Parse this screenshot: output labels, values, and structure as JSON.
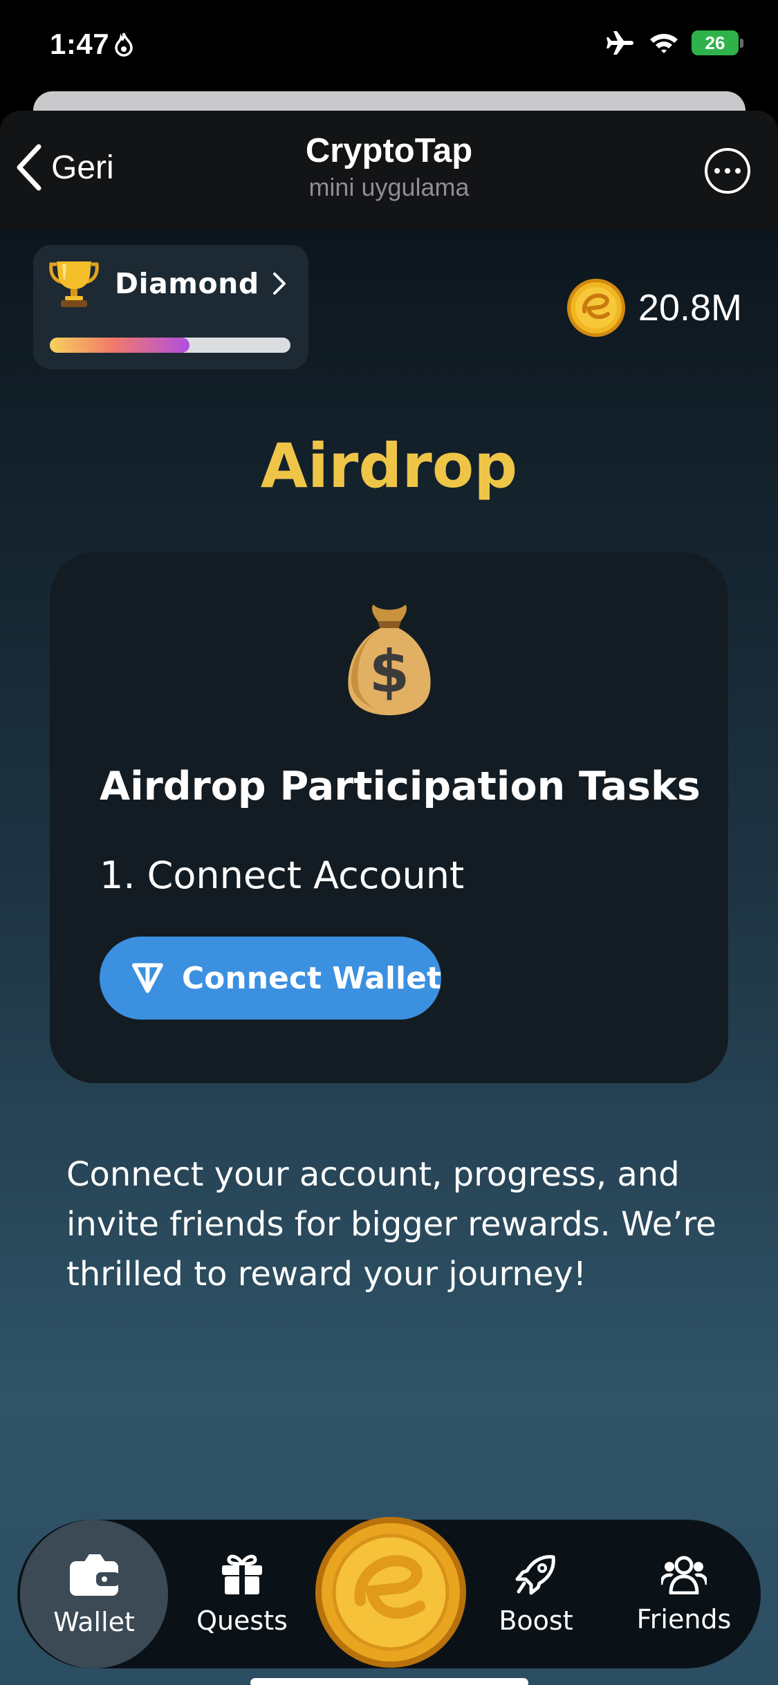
{
  "status_bar": {
    "time": "1:47",
    "battery": "26"
  },
  "telegram_header": {
    "back_label": "Geri",
    "title": "CryptoTap",
    "subtitle": "mini uygulama"
  },
  "rank": {
    "name": "Diamond",
    "progress": 0.58
  },
  "balance": {
    "value": "20.8M"
  },
  "page": {
    "title": "Airdrop"
  },
  "task_card": {
    "heading": "Airdrop Participation Tasks",
    "step": "1. Connect Account",
    "button_label": "Connect Wallet"
  },
  "description": "Connect your account, progress, and invite friends for bigger rewards. We’re thrilled to reward your journey!",
  "bottom_nav": {
    "items": [
      {
        "label": "Wallet",
        "icon": "wallet-icon",
        "active": true
      },
      {
        "label": "Quests",
        "icon": "gift-icon",
        "active": false
      },
      {
        "label": "",
        "icon": "coin-icon",
        "active": false
      },
      {
        "label": "Boost",
        "icon": "rocket-icon",
        "active": false
      },
      {
        "label": "Friends",
        "icon": "friends-icon",
        "active": false
      }
    ]
  },
  "colors": {
    "accent_gold": "#efc548",
    "button_blue": "#3b90e0",
    "battery_green": "#2fb24a"
  }
}
